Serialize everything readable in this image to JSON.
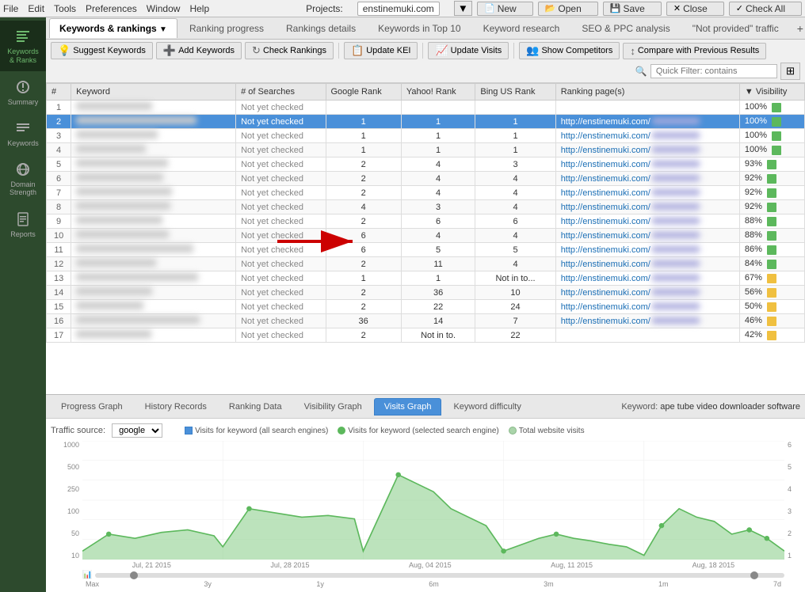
{
  "menubar": {
    "items": [
      "File",
      "Edit",
      "Tools",
      "Preferences",
      "Window",
      "Help"
    ],
    "project_label": "Projects:",
    "project_url": "enstinemuki.com",
    "buttons": [
      "New",
      "Open",
      "Save",
      "Close",
      "Check All"
    ]
  },
  "sidebar": {
    "items": [
      {
        "label": "Keywords\n& Ranks",
        "icon": "keyword-icon",
        "active": true
      },
      {
        "label": "Summary",
        "icon": "summary-icon",
        "active": false
      },
      {
        "label": "Keywords",
        "icon": "keywords-icon",
        "active": false
      },
      {
        "label": "Domain\nStrength",
        "icon": "domain-icon",
        "active": false
      },
      {
        "label": "Reports",
        "icon": "reports-icon",
        "active": false
      }
    ]
  },
  "tabs": {
    "items": [
      {
        "label": "Keywords & rankings",
        "active": true,
        "has_dropdown": true
      },
      {
        "label": "Ranking progress",
        "active": false
      },
      {
        "label": "Rankings details",
        "active": false
      },
      {
        "label": "Keywords in Top 10",
        "active": false
      },
      {
        "label": "Keyword research",
        "active": false
      },
      {
        "label": "SEO & PPC analysis",
        "active": false
      },
      {
        "label": "\"Not provided\" traffic",
        "active": false
      }
    ],
    "add_tab": "+"
  },
  "toolbar": {
    "buttons": [
      {
        "icon": "💡",
        "label": "Suggest Keywords"
      },
      {
        "icon": "+",
        "label": "Add Keywords"
      },
      {
        "icon": "↻",
        "label": "Check Rankings"
      },
      {
        "icon": "📋",
        "label": "Update KEI"
      },
      {
        "icon": "📈",
        "label": "Update Visits"
      },
      {
        "icon": "👥",
        "label": "Show Competitors"
      },
      {
        "icon": "↕",
        "label": "Compare with Previous Results"
      }
    ],
    "filter_placeholder": "Quick Filter: contains",
    "filter_icon": "🔍"
  },
  "table": {
    "columns": [
      "#",
      "Keyword",
      "# of Searches",
      "Google Rank",
      "Yahoo! Rank",
      "Bing US Rank",
      "Ranking page(s)",
      "▼ Visibility"
    ],
    "rows": [
      {
        "num": 1,
        "keyword": "",
        "searches": "Not yet checked",
        "google": "",
        "yahoo": "",
        "bing": "",
        "url": "",
        "visibility": "100%",
        "vis_color": "green",
        "selected": false
      },
      {
        "num": 2,
        "keyword": "",
        "searches": "Not yet checked",
        "google": "1",
        "yahoo": "1",
        "bing": "1",
        "url": "http://enstinemuki.com/",
        "visibility": "100%",
        "vis_color": "green",
        "selected": true
      },
      {
        "num": 3,
        "keyword": "",
        "searches": "Not yet checked",
        "google": "1",
        "yahoo": "1",
        "bing": "1",
        "url": "http://enstinemuki.com/",
        "visibility": "100%",
        "vis_color": "green",
        "selected": false
      },
      {
        "num": 4,
        "keyword": "",
        "searches": "Not yet checked",
        "google": "1",
        "yahoo": "1",
        "bing": "1",
        "url": "http://enstinemuki.com/",
        "visibility": "100%",
        "vis_color": "green",
        "selected": false
      },
      {
        "num": 5,
        "keyword": "",
        "searches": "Not yet checked",
        "google": "2",
        "yahoo": "4",
        "bing": "3",
        "url": "http://enstinemuki.com/",
        "visibility": "93%",
        "vis_color": "green",
        "selected": false
      },
      {
        "num": 6,
        "keyword": "",
        "searches": "Not yet checked",
        "google": "2",
        "yahoo": "4",
        "bing": "4",
        "url": "http://enstinemuki.com/",
        "visibility": "92%",
        "vis_color": "green",
        "selected": false
      },
      {
        "num": 7,
        "keyword": "",
        "searches": "Not yet checked",
        "google": "2",
        "yahoo": "4",
        "bing": "4",
        "url": "http://enstinemuki.com/",
        "visibility": "92%",
        "vis_color": "green",
        "selected": false
      },
      {
        "num": 8,
        "keyword": "",
        "searches": "Not yet checked",
        "google": "4",
        "yahoo": "3",
        "bing": "4",
        "url": "http://enstinemuki.com/",
        "visibility": "92%",
        "vis_color": "green",
        "selected": false
      },
      {
        "num": 9,
        "keyword": "",
        "searches": "Not yet checked",
        "google": "2",
        "yahoo": "6",
        "bing": "6",
        "url": "http://enstinemuki.com/",
        "visibility": "88%",
        "vis_color": "green",
        "selected": false
      },
      {
        "num": 10,
        "keyword": "",
        "searches": "Not yet checked",
        "google": "6",
        "yahoo": "4",
        "bing": "4",
        "url": "http://enstinemuki.com/",
        "visibility": "88%",
        "vis_color": "green",
        "selected": false
      },
      {
        "num": 11,
        "keyword": "",
        "searches": "Not yet checked",
        "google": "6",
        "yahoo": "5",
        "bing": "5",
        "url": "http://enstinemuki.com/",
        "visibility": "86%",
        "vis_color": "green",
        "selected": false
      },
      {
        "num": 12,
        "keyword": "",
        "searches": "Not yet checked",
        "google": "2",
        "yahoo": "11",
        "bing": "4",
        "url": "http://enstinemuki.com/",
        "visibility": "84%",
        "vis_color": "green",
        "selected": false
      },
      {
        "num": 13,
        "keyword": "",
        "searches": "Not yet checked",
        "google": "1",
        "yahoo": "1",
        "bing": "Not in to...",
        "url": "http://enstinemuki.com/",
        "visibility": "67%",
        "vis_color": "yellow",
        "selected": false
      },
      {
        "num": 14,
        "keyword": "",
        "searches": "Not yet checked",
        "google": "2",
        "yahoo": "36",
        "bing": "10",
        "url": "http://enstinemuki.com/",
        "visibility": "56%",
        "vis_color": "yellow",
        "selected": false
      },
      {
        "num": 15,
        "keyword": "",
        "searches": "Not yet checked",
        "google": "2",
        "yahoo": "22",
        "bing": "24",
        "url": "http://enstinemuki.com/",
        "visibility": "50%",
        "vis_color": "yellow",
        "selected": false
      },
      {
        "num": 16,
        "keyword": "",
        "searches": "Not yet checked",
        "google": "36",
        "yahoo": "14",
        "bing": "7",
        "url": "http://enstinemuki.com/",
        "visibility": "46%",
        "vis_color": "yellow",
        "selected": false
      },
      {
        "num": 17,
        "keyword": "",
        "searches": "Not yet checked",
        "google": "2",
        "yahoo": "Not in to.",
        "bing": "22",
        "url": "",
        "visibility": "42%",
        "vis_color": "yellow",
        "selected": false
      }
    ]
  },
  "bottom_tabs": {
    "items": [
      {
        "label": "Progress Graph",
        "active": false
      },
      {
        "label": "History Records",
        "active": false
      },
      {
        "label": "Ranking Data",
        "active": false
      },
      {
        "label": "Visibility Graph",
        "active": false
      },
      {
        "label": "Visits Graph",
        "active": true
      },
      {
        "label": "Keyword difficulty",
        "active": false
      }
    ],
    "keyword_label": "Keyword:",
    "keyword_value": "ape tube video downloader software"
  },
  "chart": {
    "traffic_source_label": "Traffic source:",
    "traffic_source_value": "google",
    "legend": [
      {
        "label": "Visits for keyword (all search engines)",
        "color": "#5cb85c"
      },
      {
        "label": "Visits for keyword (selected search engine)",
        "color": "#5cb85c"
      },
      {
        "label": "Total website visits",
        "color": "#aad4aa"
      }
    ],
    "y_axis_left": [
      "1000",
      "500",
      "250",
      "100",
      "50",
      "10"
    ],
    "y_axis_right": [
      "6",
      "5",
      "4",
      "3",
      "2",
      "1"
    ],
    "x_axis_labels": [
      "Jul, 21 2015",
      "Jul, 28 2015",
      "Aug, 04 2015",
      "Aug, 11 2015",
      "Aug, 18 2015"
    ],
    "range_labels": [
      "Max",
      "3y",
      "1y",
      "6m",
      "3m",
      "1m",
      "7d"
    ]
  }
}
